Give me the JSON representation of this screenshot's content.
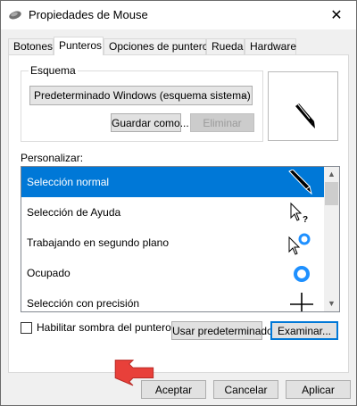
{
  "window": {
    "title": "Propiedades de Mouse",
    "close_glyph": "✕"
  },
  "tabs": [
    {
      "label": "Botones",
      "active": false
    },
    {
      "label": "Punteros",
      "active": true
    },
    {
      "label": "Opciones de puntero",
      "active": false
    },
    {
      "label": "Rueda",
      "active": false
    },
    {
      "label": "Hardware",
      "active": false
    }
  ],
  "scheme": {
    "group_label": "Esquema",
    "selected": "Predeterminado Windows (esquema sistema)",
    "save_button": "Guardar como...",
    "delete_button": "Eliminar"
  },
  "customize": {
    "label": "Personalizar:",
    "items": [
      {
        "label": "Selección normal",
        "icon": "arrow-pointer-icon",
        "selected": true
      },
      {
        "label": "Selección de Ayuda",
        "icon": "help-pointer-icon",
        "selected": false
      },
      {
        "label": "Trabajando en segundo plano",
        "icon": "working-pointer-icon",
        "selected": false
      },
      {
        "label": "Ocupado",
        "icon": "busy-pointer-icon",
        "selected": false
      },
      {
        "label": "Selección con precisión",
        "icon": "crosshair-pointer-icon",
        "selected": false
      }
    ]
  },
  "shadow": {
    "label": "Habilitar sombra del puntero",
    "checked": false
  },
  "actions": {
    "use_default": "Usar predeterminado",
    "browse": "Examinar...",
    "ok": "Aceptar",
    "cancel": "Cancelar",
    "apply": "Aplicar"
  },
  "colors": {
    "selection": "#0078d7",
    "annotation_arrow": "#e8403a"
  }
}
